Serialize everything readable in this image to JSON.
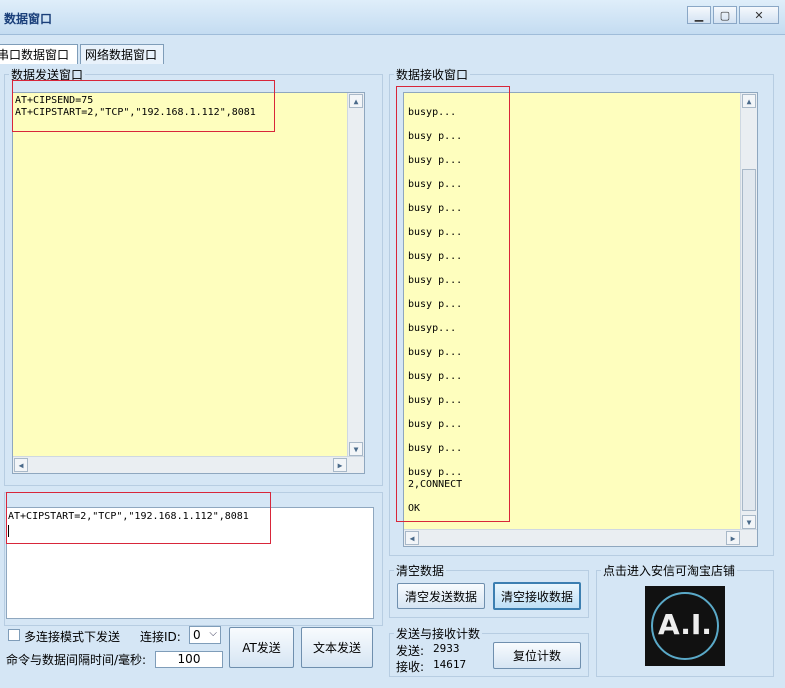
{
  "window": {
    "title": "数据窗口"
  },
  "tabs": [
    "串口数据窗口",
    "网络数据窗口"
  ],
  "send_panel": {
    "legend": "数据发送窗口",
    "lines": [
      "AT+CIPSEND=75",
      "AT+CIPSTART=2,\"TCP\",\"192.168.1.112\",8081"
    ]
  },
  "command_panel": {
    "text": "AT+CIPSTART=2,\"TCP\",\"192.168.1.112\",8081"
  },
  "controls": {
    "multi_conn_label": "多连接模式下发送",
    "conn_id_label": "连接ID:",
    "conn_id_value": "0",
    "interval_label": "命令与数据间隔时间/毫秒:",
    "interval_value": "100",
    "at_send": "AT发送",
    "text_send": "文本发送"
  },
  "receive_panel": {
    "legend": "数据接收窗口",
    "lines": [
      "busyp...",
      "busy p...",
      "busy p...",
      "busy p...",
      "busy p...",
      "busy p...",
      "busy p...",
      "busy p...",
      "busy p...",
      "busyp...",
      "busy p...",
      "busy p...",
      "busy p...",
      "busy p...",
      "busy p...",
      "busy p...",
      "2,CONNECT",
      "OK"
    ]
  },
  "clear_panel": {
    "legend": "清空数据",
    "clear_send": "清空发送数据",
    "clear_recv": "清空接收数据"
  },
  "counter_panel": {
    "legend": "发送与接收计数",
    "send_label": "发送:",
    "send_value": "2933",
    "recv_label": "接收:",
    "recv_value": "14617",
    "reset": "复位计数"
  },
  "shop_panel": {
    "legend": "点击进入安信可淘宝店铺",
    "logo_text": "A.I."
  },
  "colors": {
    "text_area": "#fefebe",
    "highlight": "#d8263a",
    "window_bg": "#d5e6f5"
  }
}
